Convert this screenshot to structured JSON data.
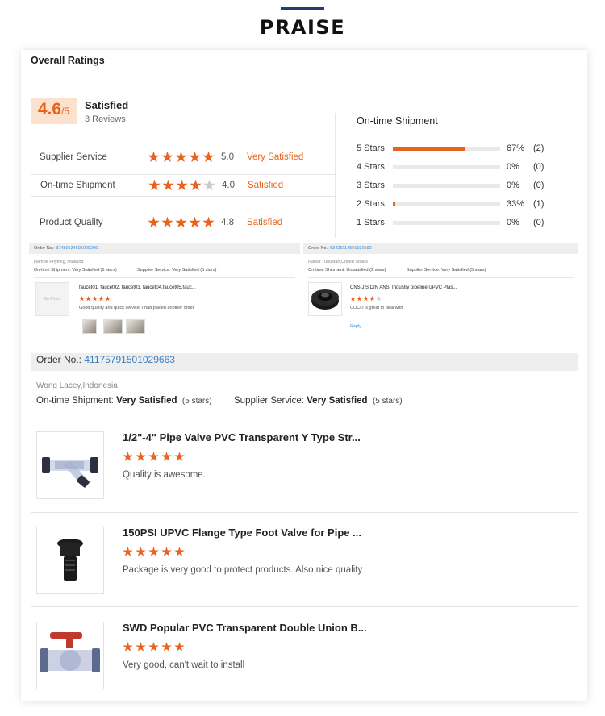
{
  "section_title": "PRAISE",
  "overall": {
    "title": "Overall Ratings",
    "score": "4.6",
    "score_suffix": "/5",
    "satisfaction": "Satisfied",
    "reviews": "3 Reviews"
  },
  "ratings": [
    {
      "label": "Supplier Service",
      "stars": 5,
      "value": "5.0",
      "word": "Very Satisfied"
    },
    {
      "label": "On-time Shipment",
      "stars": 4,
      "value": "4.0",
      "word": "Satisfied"
    },
    {
      "label": "Product Quality",
      "stars": 5,
      "value": "4.8",
      "word": "Satisfied"
    }
  ],
  "shipment": {
    "title": "On-time Shipment",
    "rows": [
      {
        "label": "5 Stars",
        "percent": 67,
        "pct_text": "67%",
        "count": "(2)"
      },
      {
        "label": "4 Stars",
        "percent": 0,
        "pct_text": "0%",
        "count": "(0)"
      },
      {
        "label": "3 Stars",
        "percent": 0,
        "pct_text": "0%",
        "count": "(0)"
      },
      {
        "label": "2 Stars",
        "percent": 2,
        "pct_text": "33%",
        "count": "(1)"
      },
      {
        "label": "1 Stars",
        "percent": 0,
        "pct_text": "0%",
        "count": "(0)"
      }
    ]
  },
  "mini_reviews": [
    {
      "order_label": "Order No.:",
      "order_no": "37480634501029206",
      "buyer": "Hampe Phyinkg,Thailand",
      "shipment_text": "On-time Shipment: Very Satisfied (5 stars)",
      "service_text": "Supplier Service: Very Satisfied (5 stars)",
      "product_title": "faucet01, faucet02, faucet03, faucet04,faucet05,fauc...",
      "stars": 5,
      "comment": "Good quality and quick service. I had placed another order.",
      "thumb_text": "No Photo"
    },
    {
      "order_label": "Order No.:",
      "order_no": "53429114501020582",
      "buyer": "Nawaf Turkistan,United States",
      "shipment_text": "On-time Shipment: Unsatisfied (2 stars)",
      "service_text": "Supplier Service: Very Satisfied (5 stars)",
      "product_title": "CNS JIS DIN ANSI Industry pipeline UPVC Plas...",
      "stars": 4,
      "comment": "COCO is great to deal with",
      "reply": "Reply"
    }
  ],
  "main_review": {
    "order_label": "Order No.:",
    "order_no": "41175791501029663",
    "buyer": "Wong Lacey,Indonesia",
    "shipment_label": "On-time Shipment:",
    "shipment_value": "Very Satisfied",
    "shipment_stars": "(5 stars)",
    "service_label": "Supplier Service:",
    "service_value": "Very Satisfied",
    "service_stars": "(5 stars)",
    "products": [
      {
        "title": "1/2\"-4\" Pipe Valve PVC Transparent Y Type Str...",
        "stars": 5,
        "comment": "Quality is awesome.",
        "icon": "y-strainer-icon"
      },
      {
        "title": "150PSI UPVC Flange Type Foot Valve for Pipe ...",
        "stars": 5,
        "comment": "Package is very good to protect products. Also nice quality",
        "icon": "foot-valve-icon"
      },
      {
        "title": "SWD Popular PVC Transparent Double Union B...",
        "stars": 5,
        "comment": "Very good, can't wait to install",
        "icon": "ball-valve-icon"
      }
    ]
  },
  "colors": {
    "accent": "#e8641d",
    "link": "#3a7fc1",
    "navy": "#1f3f73"
  }
}
